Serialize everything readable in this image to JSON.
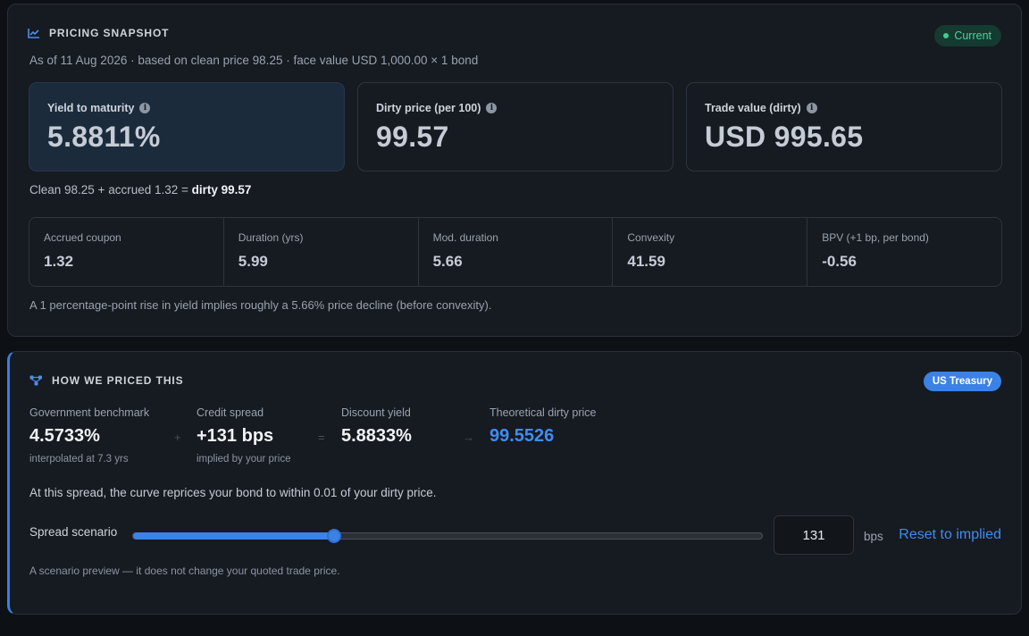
{
  "snapshot": {
    "title": "PRICING SNAPSHOT",
    "title_icon": "line-chart-icon",
    "status_badge": "Current",
    "as_of": "As of 11 Aug 2026 · based on clean price 98.25 · face value USD 1,000.00 × 1 bond",
    "metrics": [
      {
        "label": "Yield to maturity",
        "value": "5.8811%",
        "highlighted": true
      },
      {
        "label": "Dirty price (per 100)",
        "value": "99.57",
        "highlighted": false
      },
      {
        "label": "Trade value (dirty)",
        "value": "USD 995.65",
        "highlighted": false
      }
    ],
    "dirty_line_prefix": "Clean 98.25 + accrued 1.32 = ",
    "dirty_line_bold": "dirty 99.57",
    "stats": [
      {
        "label": "Accrued coupon",
        "value": "1.32"
      },
      {
        "label": "Duration (yrs)",
        "value": "5.99"
      },
      {
        "label": "Mod. duration",
        "value": "5.66"
      },
      {
        "label": "Convexity",
        "value": "41.59"
      },
      {
        "label": "BPV (+1 bp, per bond)",
        "value": "-0.56"
      }
    ],
    "note": "A 1 percentage-point rise in yield implies roughly a 5.66% price decline (before convexity)."
  },
  "how_priced": {
    "title": "HOW WE PRICED THIS",
    "title_icon": "network-nodes-icon",
    "badge": "US Treasury",
    "components": [
      {
        "label": "Government benchmark",
        "value": "4.5733%",
        "sub": "interpolated at 7.3 yrs"
      },
      {
        "label": "Credit spread",
        "value": "+131 bps",
        "sub": "implied by your price"
      },
      {
        "label": "Discount yield",
        "value": "5.8833%",
        "sub": ""
      },
      {
        "label": "Theoretical dirty price",
        "value": "99.5526",
        "sub": ""
      }
    ],
    "operators": [
      "+",
      "=",
      "→"
    ],
    "reprice_text": "At this spread, the curve reprices your bond to within 0.01 of your dirty price.",
    "slider": {
      "label": "Spread scenario",
      "value": "131",
      "unit": "bps",
      "fraction": 0.32,
      "reset_label": "Reset to implied"
    },
    "note": "A scenario preview — it does not change your quoted trade price."
  },
  "colors": {
    "accent": "#3b82e6",
    "success": "#3ecf8e"
  }
}
